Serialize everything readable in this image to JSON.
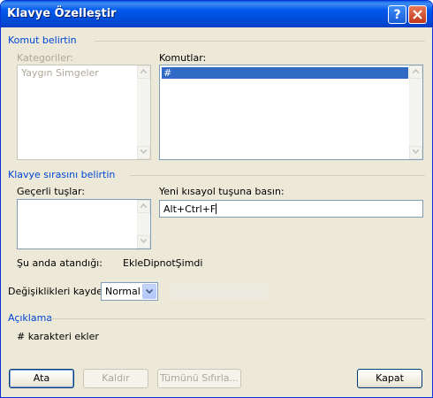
{
  "window": {
    "title": "Klavye Özelleştir",
    "help_glyph": "?"
  },
  "commands_section": {
    "heading": "Komut belirtin",
    "categories_label": "Kategoriler:",
    "categories_items": [
      "Yaygın Simgeler"
    ],
    "commands_label": "Komutlar:",
    "commands_items": [
      "#"
    ]
  },
  "keys_section": {
    "heading": "Klavye sırasını belirtin",
    "current_keys_label": "Geçerli tuşlar:",
    "new_shortcut_label": "Yeni kısayol tuşuna basın:",
    "new_shortcut_value": "Alt+Ctrl+F",
    "assigned_label": "Şu anda atandığı:",
    "assigned_value": "EkleDipnotŞimdi"
  },
  "save_changes": {
    "label": "Değişiklikleri kaydet:",
    "value": "Normal"
  },
  "description": {
    "heading": "Açıklama",
    "text": "# karakteri ekler"
  },
  "buttons": {
    "assign": "Ata",
    "remove": "Kaldır",
    "reset_all": "Tümünü Sıfırla...",
    "close": "Kapat"
  },
  "icons": {
    "help": "help-icon",
    "close": "close-icon",
    "scroll_up": "chevron-up-icon",
    "scroll_down": "chevron-down-icon",
    "dropdown": "chevron-down-icon"
  },
  "colors": {
    "title_bar": "#0058ee",
    "section_heading": "#0046d5",
    "selection": "#316ac5",
    "dialog_bg": "#ece9d8"
  }
}
